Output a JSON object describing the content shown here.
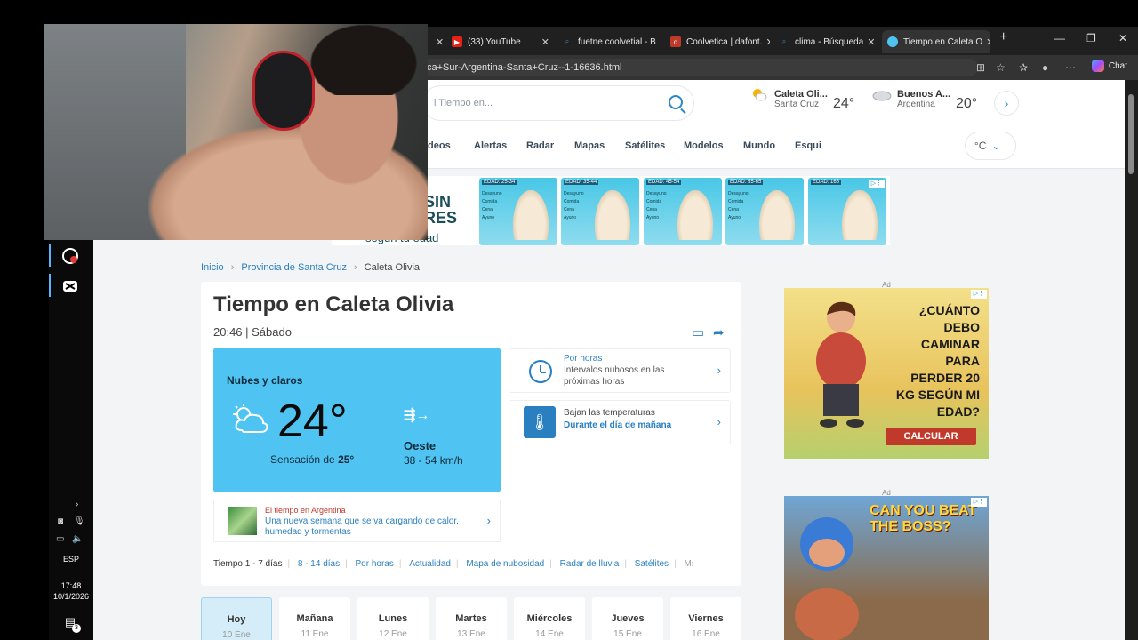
{
  "taskbar": {
    "lang": "ESP",
    "time": "17:48",
    "date": "10/1/2026",
    "notif_count": "3"
  },
  "browser": {
    "tabs": [
      {
        "title": "(33) YouTube",
        "icon": "youtube-icon",
        "color": "#e62117"
      },
      {
        "title": "fuetne coolvetial - B",
        "icon": "search-icon",
        "color": "#2a87c9"
      },
      {
        "title": "Coolvetica | dafont.",
        "icon": "dafont-icon",
        "color": "#c0392b"
      },
      {
        "title": "clima - Búsqueda",
        "icon": "search-icon",
        "color": "#2a87c9"
      },
      {
        "title": "Tiempo en Caleta O",
        "icon": "site-icon",
        "color": "#4fc3f2"
      }
    ],
    "url": "ca+Sur-Argentina-Santa+Cruz--1-16636.html",
    "chat_label": "Chat"
  },
  "site": {
    "search_placeholder": "l Tiempo en...",
    "cities": [
      {
        "name": "Caleta Oli...",
        "province": "Santa Cruz",
        "temp": "24°"
      },
      {
        "name": "Buenos A...",
        "province": "Argentina",
        "temp": "20°"
      }
    ],
    "nav": [
      "ídeos",
      "Alertas",
      "Radar",
      "Mapas",
      "Satélites",
      "Modelos",
      "Mundo",
      "Esqui"
    ],
    "unit": "°C",
    "ad_banner": {
      "text_lines": [
        "SIN",
        "RES"
      ],
      "sub": "según tu edad",
      "tiles": [
        "EDAD: 25-34",
        "EDAD: 35-44",
        "EDAD: 45-54",
        "EDAD: 55-65",
        "EDAD: 165"
      ],
      "tile_lines": [
        "Desayuno",
        "Comida",
        "Cena",
        "Ayuno"
      ]
    },
    "breadcrumb": [
      "Inicio",
      "Provincia de Santa Cruz",
      "Caleta Olivia"
    ],
    "title": "Tiempo en Caleta Olivia",
    "subtitle": "20:46 | Sábado",
    "now": {
      "condition": "Nubes y claros",
      "temp": "24°",
      "feels_prefix": "Sensación de ",
      "feels_value": "25°",
      "wind_dir": "Oeste",
      "wind_speed": "38 - 54 km/h"
    },
    "hourly_box": {
      "label": "Por horas",
      "text": "Intervalos nubosos en las próximas horas"
    },
    "temp_box": {
      "label": "Bajan las temperaturas",
      "text": "Durante el día de mañana"
    },
    "news": {
      "source": "El tiempo en Argentina",
      "headline": "Una nueva semana que se va cargando de calor, humedad y tormentas"
    },
    "subnav": [
      "Tiempo 1 - 7 días",
      "8 - 14 días",
      "Por horas",
      "Actualidad",
      "Mapa de nubosidad",
      "Radar de lluvia",
      "Satélites",
      "M"
    ],
    "days": [
      {
        "name": "Hoy",
        "date": "10 Ene"
      },
      {
        "name": "Mañana",
        "date": "11 Ene"
      },
      {
        "name": "Lunes",
        "date": "12 Ene"
      },
      {
        "name": "Martes",
        "date": "13 Ene"
      },
      {
        "name": "Miércoles",
        "date": "14 Ene"
      },
      {
        "name": "Jueves",
        "date": "15 Ene"
      },
      {
        "name": "Viernes",
        "date": "16 Ene"
      }
    ],
    "side_ads": [
      {
        "label": "Ad",
        "text": "¿CUÁNTO DEBO CAMINAR PARA PERDER 20 KG SEGÚN MI EDAD?",
        "cta": "CALCULAR"
      },
      {
        "label": "Ad",
        "text": "CAN YOU BEAT THE BOSS?"
      }
    ]
  }
}
